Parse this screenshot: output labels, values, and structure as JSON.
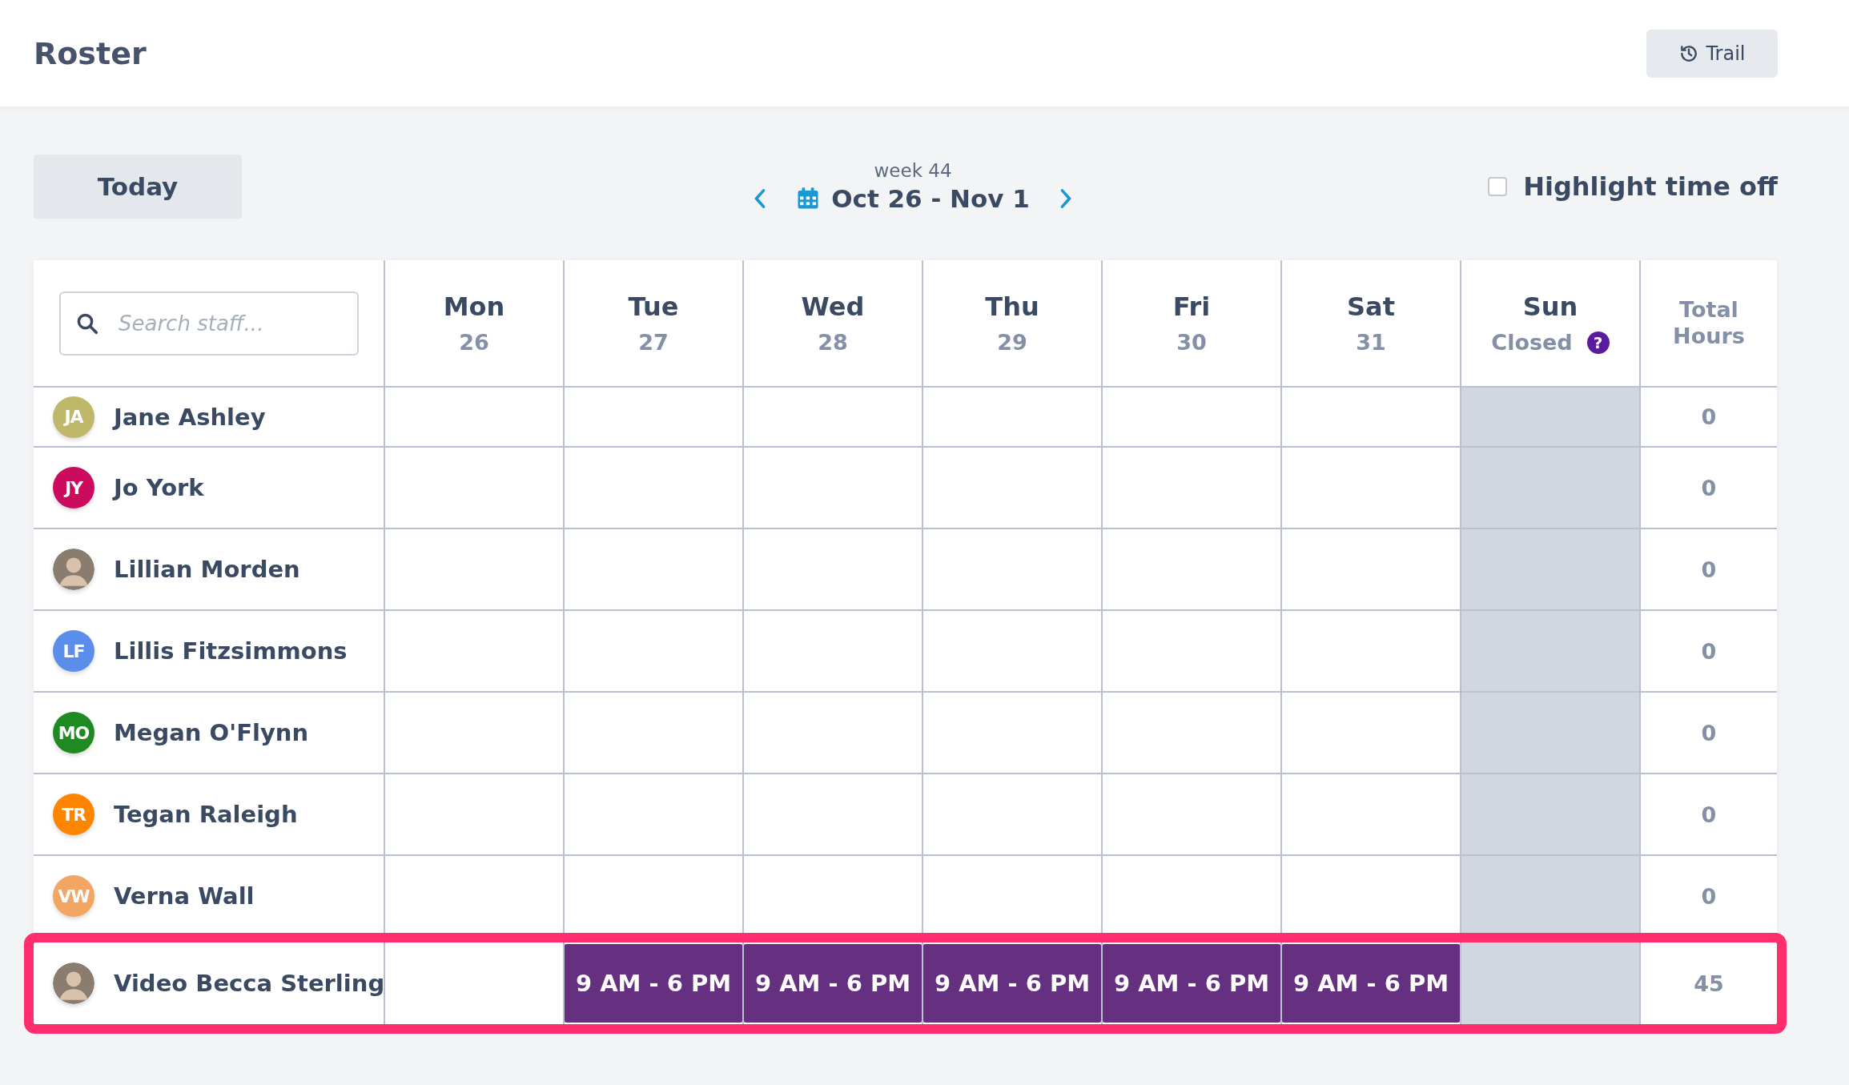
{
  "page": {
    "title": "Roster"
  },
  "trail_button": {
    "label": "Trail"
  },
  "today_button": {
    "label": "Today"
  },
  "week_nav": {
    "week_label": "week 44",
    "range": "Oct 26 - Nov 1"
  },
  "highlight_time_off": {
    "label": "Highlight time off",
    "checked": false
  },
  "search": {
    "placeholder": "Search staff..."
  },
  "days": [
    {
      "name": "Mon",
      "sub": "26",
      "closed": false
    },
    {
      "name": "Tue",
      "sub": "27",
      "closed": false
    },
    {
      "name": "Wed",
      "sub": "28",
      "closed": false
    },
    {
      "name": "Thu",
      "sub": "29",
      "closed": false
    },
    {
      "name": "Fri",
      "sub": "30",
      "closed": false
    },
    {
      "name": "Sat",
      "sub": "31",
      "closed": false
    },
    {
      "name": "Sun",
      "sub": "Closed",
      "closed": true,
      "help": "?"
    }
  ],
  "total_heading": "Total Hours",
  "rows": [
    {
      "name": "Jane Ashley",
      "avatar": {
        "kind": "initials",
        "initials": "JA",
        "color": "#bfb86a"
      },
      "cells": [
        {
          "kind": "empty"
        },
        {
          "kind": "empty"
        },
        {
          "kind": "empty"
        },
        {
          "kind": "empty"
        },
        {
          "kind": "empty"
        },
        {
          "kind": "empty"
        },
        {
          "kind": "empty"
        }
      ],
      "total": "0",
      "highlighted": false
    },
    {
      "name": "Jo York",
      "avatar": {
        "kind": "initials",
        "initials": "JY",
        "color": "#cc0a5e"
      },
      "cells": [
        {
          "kind": "empty"
        },
        {
          "kind": "empty"
        },
        {
          "kind": "empty"
        },
        {
          "kind": "empty"
        },
        {
          "kind": "empty"
        },
        {
          "kind": "empty"
        },
        {
          "kind": "empty"
        }
      ],
      "total": "0",
      "highlighted": false
    },
    {
      "name": "Lillian Morden",
      "avatar": {
        "kind": "photo"
      },
      "cells": [
        {
          "kind": "empty"
        },
        {
          "kind": "empty"
        },
        {
          "kind": "empty"
        },
        {
          "kind": "empty"
        },
        {
          "kind": "empty"
        },
        {
          "kind": "empty"
        },
        {
          "kind": "empty"
        }
      ],
      "total": "0",
      "highlighted": false
    },
    {
      "name": "Lillis Fitzsimmons",
      "avatar": {
        "kind": "initials",
        "initials": "LF",
        "color": "#5b8dea"
      },
      "cells": [
        {
          "kind": "empty"
        },
        {
          "kind": "empty"
        },
        {
          "kind": "empty"
        },
        {
          "kind": "empty"
        },
        {
          "kind": "empty"
        },
        {
          "kind": "empty"
        },
        {
          "kind": "empty"
        }
      ],
      "total": "0",
      "highlighted": false
    },
    {
      "name": "Megan O'Flynn",
      "avatar": {
        "kind": "initials",
        "initials": "MO",
        "color": "#1f8a22"
      },
      "cells": [
        {
          "kind": "empty"
        },
        {
          "kind": "empty"
        },
        {
          "kind": "empty"
        },
        {
          "kind": "empty"
        },
        {
          "kind": "empty"
        },
        {
          "kind": "empty"
        },
        {
          "kind": "empty"
        }
      ],
      "total": "0",
      "highlighted": false
    },
    {
      "name": "Tegan Raleigh",
      "avatar": {
        "kind": "initials",
        "initials": "TR",
        "color": "#ff8500"
      },
      "cells": [
        {
          "kind": "empty"
        },
        {
          "kind": "empty"
        },
        {
          "kind": "empty"
        },
        {
          "kind": "empty"
        },
        {
          "kind": "empty"
        },
        {
          "kind": "empty"
        },
        {
          "kind": "empty"
        }
      ],
      "total": "0",
      "highlighted": false
    },
    {
      "name": "Verna Wall",
      "avatar": {
        "kind": "initials",
        "initials": "VW",
        "color": "#f3a563"
      },
      "cells": [
        {
          "kind": "empty"
        },
        {
          "kind": "empty"
        },
        {
          "kind": "empty"
        },
        {
          "kind": "empty"
        },
        {
          "kind": "empty"
        },
        {
          "kind": "empty"
        },
        {
          "kind": "empty"
        }
      ],
      "total": "0",
      "highlighted": false
    },
    {
      "name": "Video Becca Sterling",
      "avatar": {
        "kind": "photo"
      },
      "cells": [
        {
          "kind": "empty"
        },
        {
          "kind": "shift",
          "text": "9 AM - 6 PM"
        },
        {
          "kind": "shift",
          "text": "9 AM - 6 PM"
        },
        {
          "kind": "shift",
          "text": "9 AM - 6 PM"
        },
        {
          "kind": "shift",
          "text": "9 AM - 6 PM"
        },
        {
          "kind": "shift",
          "text": "9 AM - 6 PM"
        },
        {
          "kind": "empty"
        }
      ],
      "total": "45",
      "highlighted": true
    }
  ]
}
